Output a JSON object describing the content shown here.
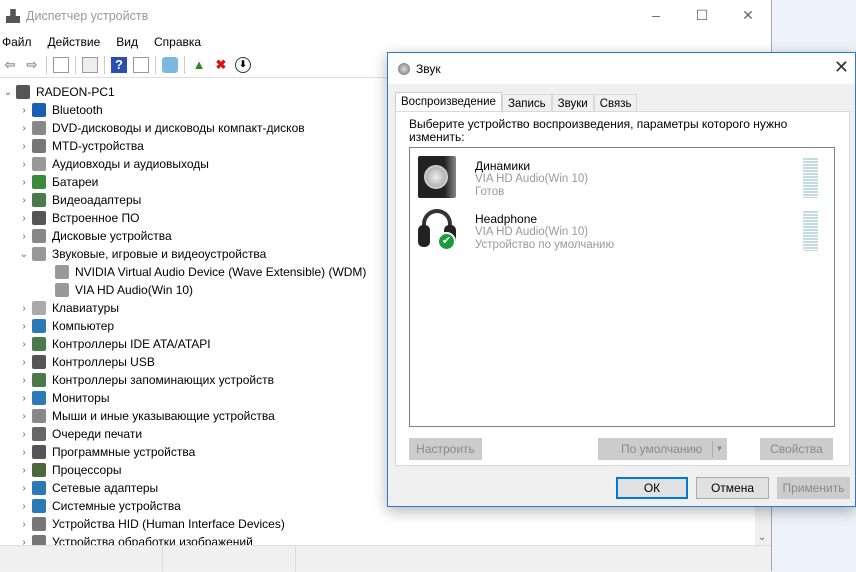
{
  "device_manager": {
    "title": "Диспетчер устройств",
    "window_controls": [
      "–",
      "☐",
      "✕"
    ],
    "menu": [
      "Файл",
      "Действие",
      "Вид",
      "Справка"
    ],
    "toolbar_icons": [
      "back-icon",
      "forward-icon",
      "show-hide-icon",
      "properties-icon",
      "help-icon",
      "view-icon",
      "scan-hardware-icon",
      "update-driver-icon",
      "uninstall-icon",
      "disable-icon"
    ],
    "root": "RADEON-PC1",
    "tree": [
      {
        "label": "Bluetooth",
        "color": "#1a5fb4"
      },
      {
        "label": "DVD-дисководы и дисководы компакт-дисков",
        "color": "#888"
      },
      {
        "label": "MTD-устройства",
        "color": "#777"
      },
      {
        "label": "Аудиовходы и аудиовыходы",
        "color": "#999"
      },
      {
        "label": "Батареи",
        "color": "#3a8a3a"
      },
      {
        "label": "Видеоадаптеры",
        "color": "#4a7a4a"
      },
      {
        "label": "Встроенное ПО",
        "color": "#555"
      },
      {
        "label": "Дисковые устройства",
        "color": "#888"
      },
      {
        "label": "Звуковые, игровые и видеоустройства",
        "color": "#999",
        "expanded": true,
        "children": [
          "NVIDIA Virtual Audio Device (Wave Extensible) (WDM)",
          "VIA HD Audio(Win 10)"
        ]
      },
      {
        "label": "Клавиатуры",
        "color": "#aaa"
      },
      {
        "label": "Компьютер",
        "color": "#2a7ab8"
      },
      {
        "label": "Контроллеры IDE ATA/ATAPI",
        "color": "#4a7a4a"
      },
      {
        "label": "Контроллеры USB",
        "color": "#555"
      },
      {
        "label": "Контроллеры запоминающих устройств",
        "color": "#4a7a4a"
      },
      {
        "label": "Мониторы",
        "color": "#2a7ab8"
      },
      {
        "label": "Мыши и иные указывающие устройства",
        "color": "#888"
      },
      {
        "label": "Очереди печати",
        "color": "#666"
      },
      {
        "label": "Программные устройства",
        "color": "#555"
      },
      {
        "label": "Процессоры",
        "color": "#4a6a3a"
      },
      {
        "label": "Сетевые адаптеры",
        "color": "#2a7ab8"
      },
      {
        "label": "Системные устройства",
        "color": "#2a7ab8"
      },
      {
        "label": "Устройства HID (Human Interface Devices)",
        "color": "#777"
      },
      {
        "label": "Устройства обработки изображений",
        "color": "#777"
      }
    ]
  },
  "sound_dialog": {
    "title": "Звук",
    "close": "✕",
    "tabs": [
      "Воспроизведение",
      "Запись",
      "Звуки",
      "Связь"
    ],
    "instruction": "Выберите устройство воспроизведения, параметры которого нужно изменить:",
    "devices": [
      {
        "name": "Динамики",
        "driver": "VIA HD Audio(Win 10)",
        "status": "Готов"
      },
      {
        "name": "Headphone",
        "driver": "VIA HD Audio(Win 10)",
        "status": "Устройство по умолчанию",
        "default": true
      }
    ],
    "buttons": {
      "configure": "Настроить",
      "set_default": "По умолчанию",
      "properties": "Свойства",
      "ok": "ОК",
      "cancel": "Отмена",
      "apply": "Применить"
    }
  }
}
